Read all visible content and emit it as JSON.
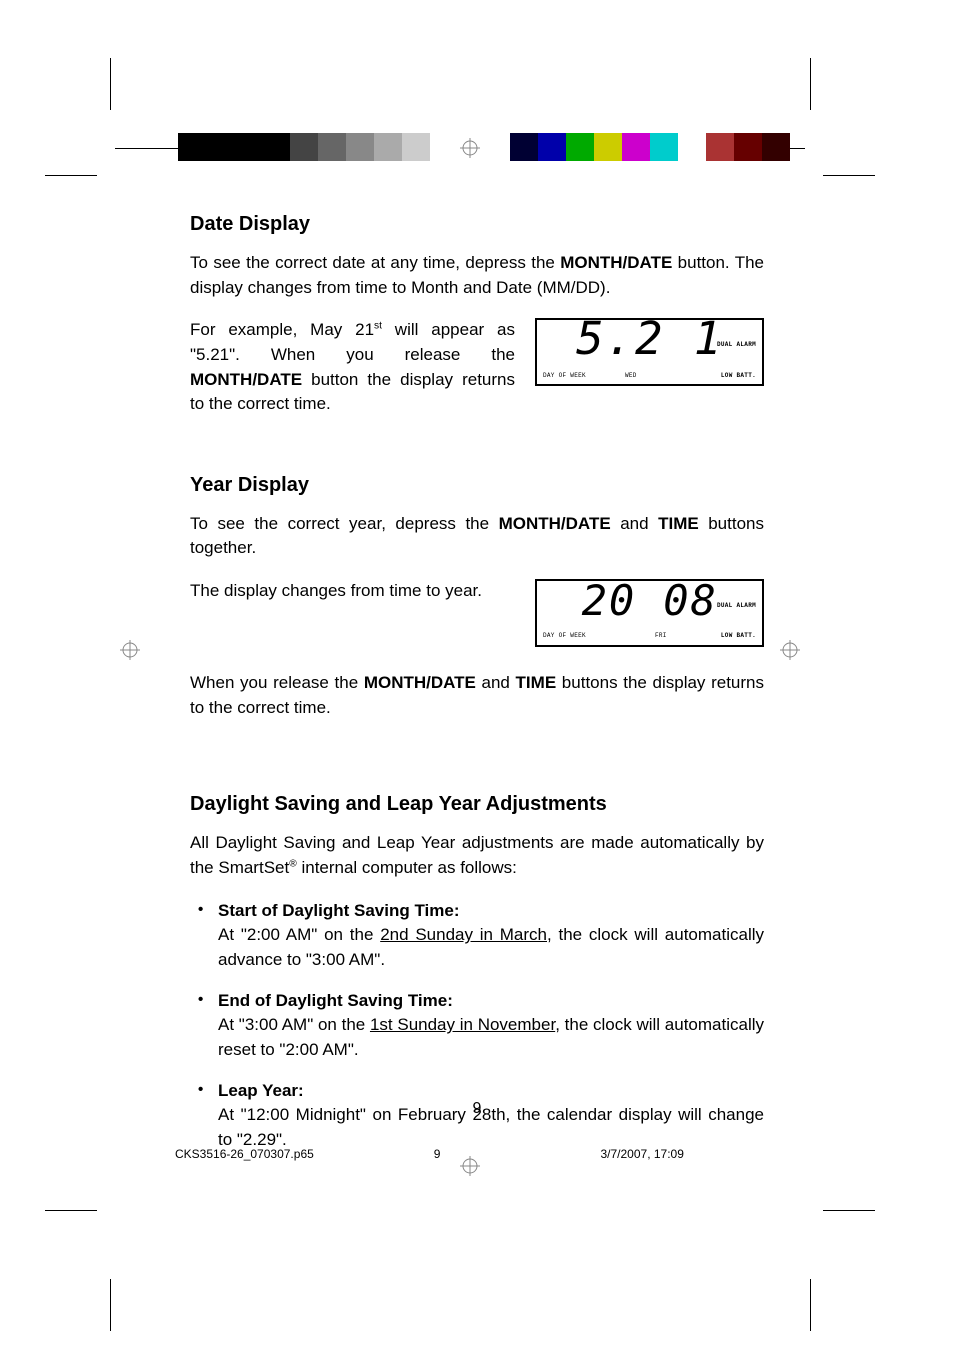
{
  "section1": {
    "heading": "Date Display",
    "para1_pre": "To see the correct date at any time, depress the ",
    "para1_btn": "MONTH/DATE",
    "para1_post": " button. The display changes from time to Month and Date (MM/DD).",
    "para2_pre": "For example, May 21",
    "para2_sup": "st",
    "para2_mid": " will appear as \"5.21\". When you release the ",
    "para2_btn": "MONTH/DATE",
    "para2_post": " button the display returns to the correct time."
  },
  "lcd1": {
    "digits": "5.2 1",
    "dow": "DAY OF WEEK",
    "mid": "WED",
    "low": "LOW BATT.",
    "dual": "DUAL\nALARM"
  },
  "section2": {
    "heading": "Year Display",
    "para1_pre": "To see the correct year, depress the ",
    "para1_btn1": "MONTH/DATE",
    "para1_and": " and ",
    "para1_btn2": "TIME",
    "para1_post": " buttons together.",
    "para2": "The display changes from time to year.",
    "para3_pre": "When you release the ",
    "para3_btn1": "MONTH/DATE",
    "para3_and": " and ",
    "para3_btn2": "TIME",
    "para3_post": " buttons the display returns to the correct time."
  },
  "lcd2": {
    "digits": "20 08",
    "dow": "DAY OF WEEK",
    "mid": "FRI",
    "low": "LOW BATT.",
    "dual": "DUAL\nALARM"
  },
  "section3": {
    "heading": "Daylight Saving and Leap Year Adjustments",
    "intro_pre": "All Daylight Saving and Leap Year adjustments are made automatically by the SmartSet",
    "intro_sup": "®",
    "intro_post": " internal computer as follows:",
    "items": [
      {
        "title": "Start of Daylight Saving Time:",
        "body_pre": "At \"2:00 AM\" on the ",
        "body_u": "2nd Sunday in March",
        "body_post": ", the clock will automatically advance to \"3:00 AM\"."
      },
      {
        "title": "End of Daylight Saving Time:",
        "body_pre": "At \"3:00 AM\" on the ",
        "body_u": "1st Sunday in November",
        "body_post": ", the clock will automatically reset to \"2:00 AM\"."
      },
      {
        "title": "Leap Year:",
        "body_pre": "At \"12:00 Midnight\" on February 28th, the calendar display will change to \"2.29\".",
        "body_u": "",
        "body_post": ""
      }
    ]
  },
  "pagenum": "9",
  "footer": {
    "file": "CKS3516-26_070307.p65",
    "page": "9",
    "datetime": "3/7/2007, 17:09"
  },
  "colorbar_left": [
    "#000",
    "#000",
    "#000",
    "#000",
    "#444",
    "#666",
    "#888",
    "#aaa",
    "#ccc",
    "#fff"
  ],
  "colorbar_right": [
    "#003",
    "#00a",
    "#0a0",
    "#cc0",
    "#c0c",
    "#0cc",
    "#fff",
    "#a33",
    "#600",
    "#300"
  ]
}
